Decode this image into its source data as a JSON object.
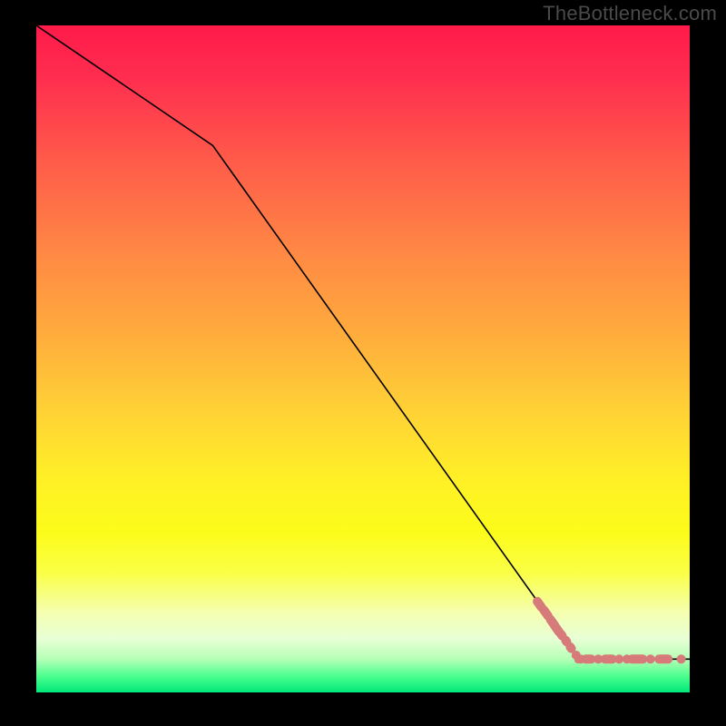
{
  "watermark": "TheBottleneck.com",
  "chart_data": {
    "type": "line",
    "title": "",
    "xlabel": "",
    "ylabel": "",
    "xlim": [
      0,
      100
    ],
    "ylim": [
      0,
      100
    ],
    "series": [
      {
        "name": "curve",
        "x": [
          0,
          27,
          83,
          100
        ],
        "values": [
          100,
          82,
          5,
          5
        ],
        "style": "line"
      },
      {
        "name": "threshold-markers-diagonal",
        "x": [
          77,
          78,
          79,
          79.7,
          80.4,
          81.1,
          81.8,
          82.6,
          83
        ],
        "values": [
          13.2,
          11.9,
          10.5,
          9.5,
          8.6,
          7.7,
          6.7,
          5.6,
          5
        ],
        "style": "markers"
      },
      {
        "name": "threshold-markers-flat",
        "x": [
          83.3,
          84.5,
          86,
          87.6,
          89.2,
          90.4,
          92.0,
          94.0,
          96.0,
          98.7
        ],
        "values": [
          5,
          5,
          5,
          5,
          5,
          5,
          5,
          5,
          5,
          5
        ],
        "style": "markers"
      }
    ],
    "colors": {
      "line": "#000000",
      "markers": "#d77a7a",
      "gradient_top": "#ff1a4a",
      "gradient_bottom": "#00e87a"
    }
  }
}
